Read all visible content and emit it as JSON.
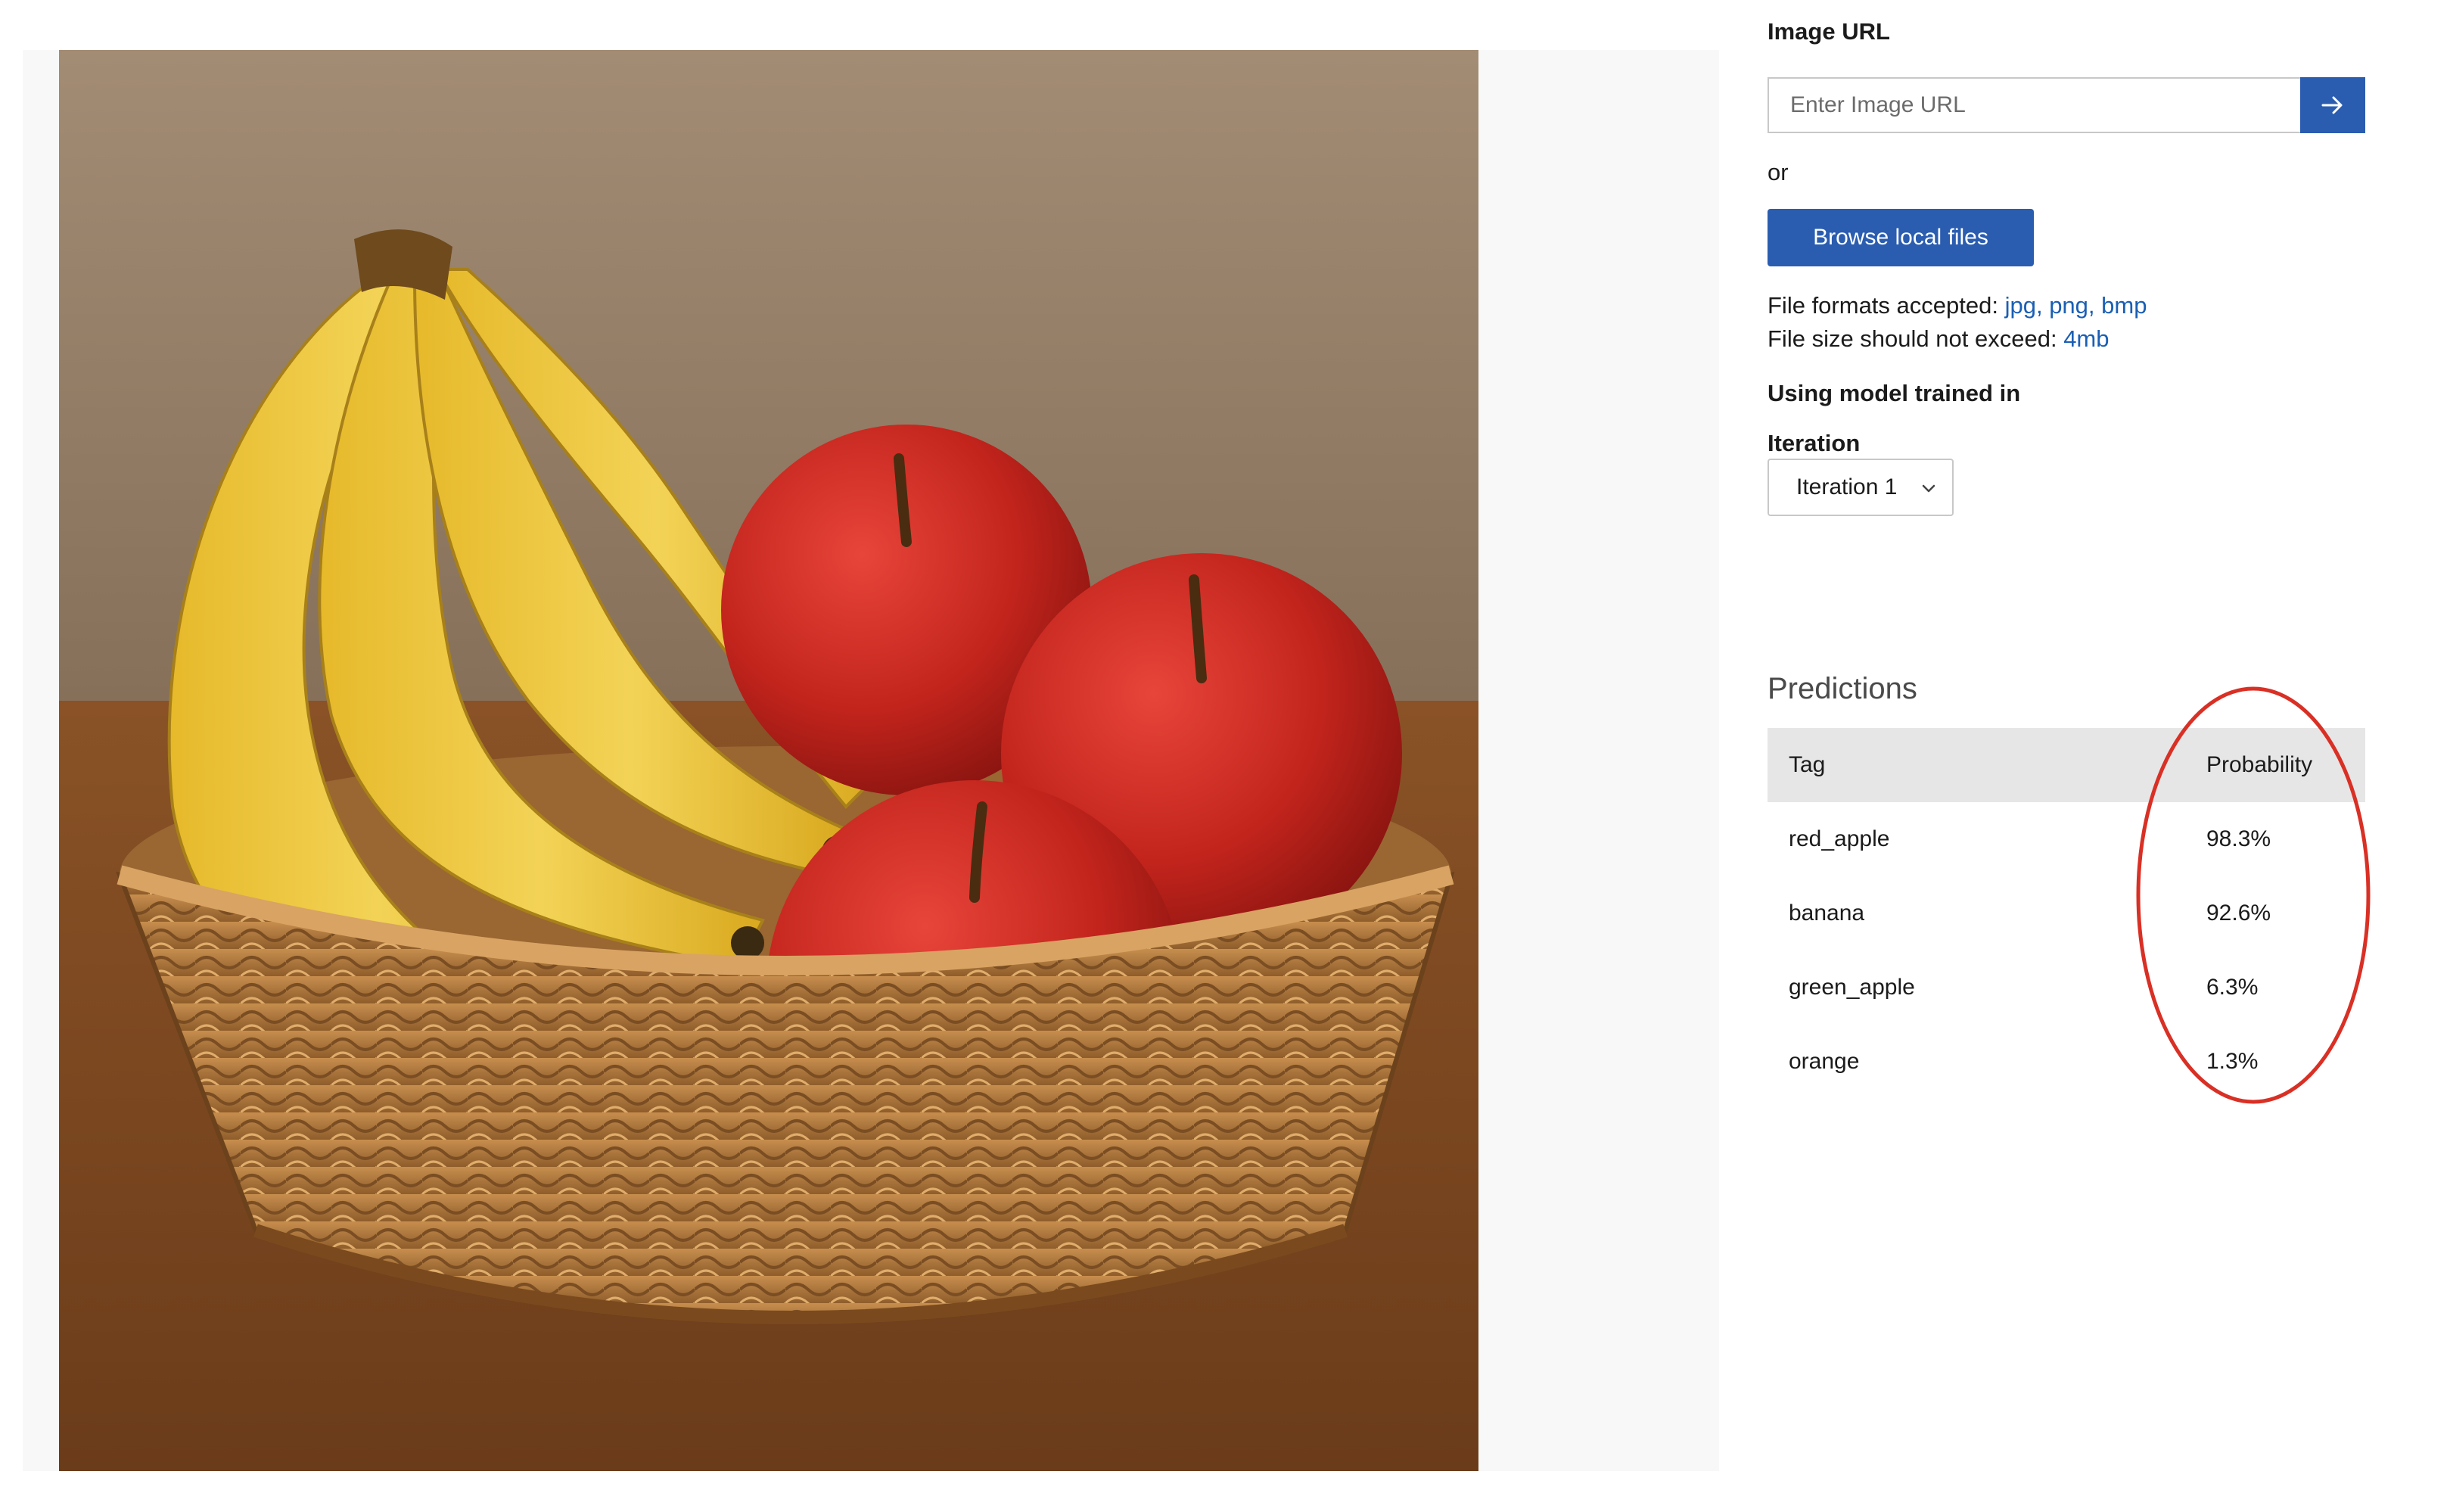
{
  "upload": {
    "image_url_label": "Image URL",
    "image_url_placeholder": "Enter Image URL",
    "image_url_value": "",
    "go_icon": "arrow-right-icon",
    "or_text": "or",
    "browse_label": "Browse local files",
    "formats_label": "File formats accepted:",
    "formats_value": "jpg, png, bmp",
    "size_label": "File size should not exceed:",
    "size_value": "4mb"
  },
  "model": {
    "trained_label": "Using model trained in",
    "iteration_label": "Iteration",
    "iteration_selected": "Iteration 1"
  },
  "predictions": {
    "title": "Predictions",
    "columns": {
      "tag": "Tag",
      "probability": "Probability"
    },
    "rows": [
      {
        "tag": "red_apple",
        "probability": "98.3%"
      },
      {
        "tag": "banana",
        "probability": "92.6%"
      },
      {
        "tag": "green_apple",
        "probability": "6.3%"
      },
      {
        "tag": "orange",
        "probability": "1.3%"
      }
    ]
  },
  "colors": {
    "accent": "#2a5db0",
    "link": "#1a5fb4",
    "annotation": "#d93025"
  }
}
